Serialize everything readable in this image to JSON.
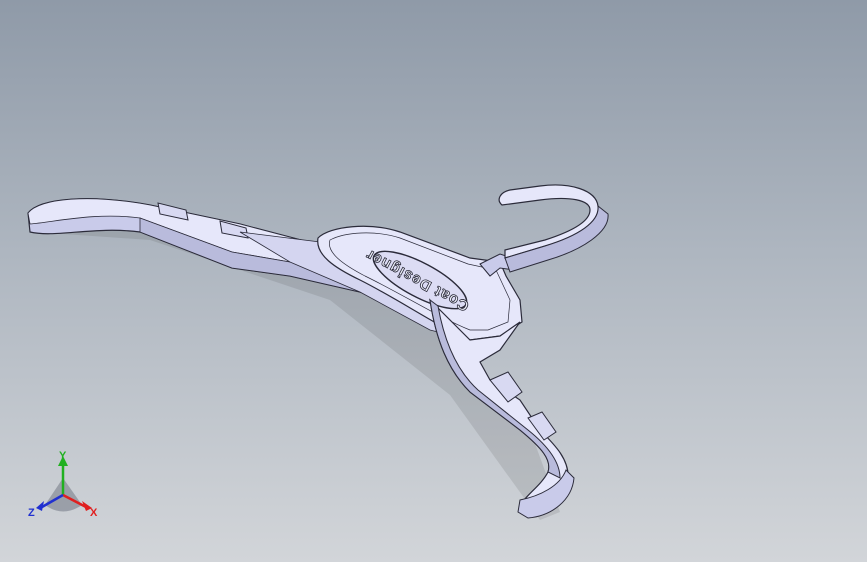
{
  "viewport": {
    "background_top": "#8f9aa8",
    "background_bottom": "#d2d5d9"
  },
  "model": {
    "name": "hanger",
    "emboss_text": "Coat Designer",
    "body_color": "#c9cbea",
    "face_color": "#e6e7fa",
    "edge_color": "#2b2b3a"
  },
  "triad": {
    "x_label": "X",
    "y_label": "Y",
    "z_label": "Z",
    "x_color": "#e02020",
    "y_color": "#20b020",
    "z_color": "#2030d0"
  }
}
